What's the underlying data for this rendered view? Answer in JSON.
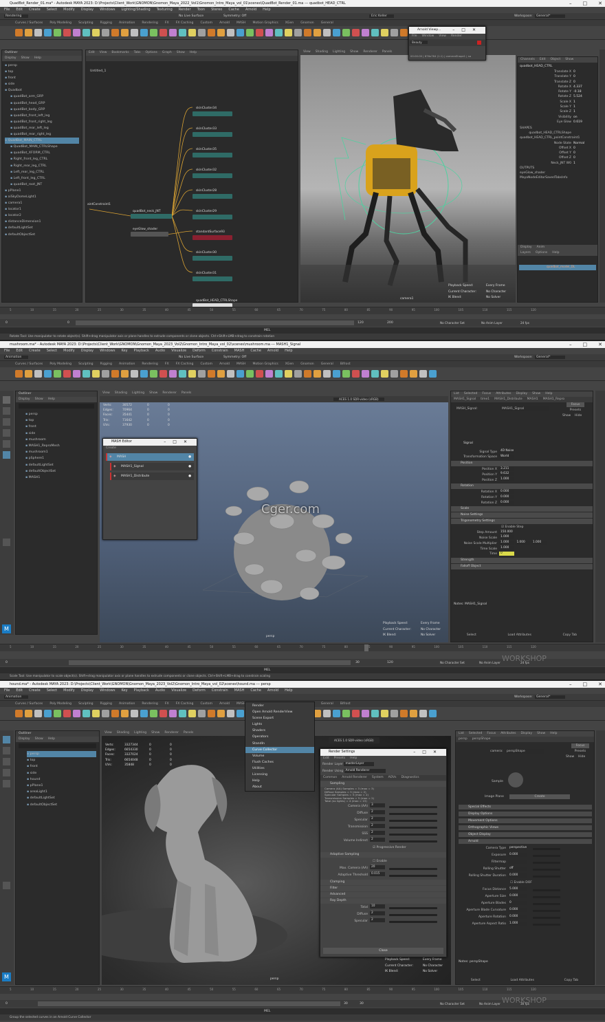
{
  "w1": {
    "title": "QuadBot_Render_01.ma* - Autodesk MAYA 2023: D:\\Projects\\Client_Work\\GNOMON\\Gnomon_Maya_2022_Vol1\\Gnomon_Intro_Maya_vol_01\\scenes\\QuadBot_Render_01.ma  ---  quadbot_HEAD_CTRL",
    "menus": [
      "File",
      "Edit",
      "Create",
      "Select",
      "Modify",
      "Display",
      "Windows",
      "Lighting/Shading",
      "Texturing",
      "Render",
      "Toon",
      "Stereo",
      "Cache",
      "Arnold",
      "Help"
    ],
    "workspace_label": "Workspace:",
    "workspace_value": "General*",
    "menuset": "Rendering",
    "live_surface": "No Live Surface",
    "symmetry": "Symmetry: Off",
    "user": "Eric Keller",
    "shelf_tabs": [
      "Curves / Surfaces",
      "Poly Modeling",
      "Sculpting",
      "Rigging",
      "Animation",
      "Rendering",
      "FX",
      "FX Caching",
      "Custom",
      "Arnold",
      "MASH",
      "Motion Graphics",
      "XGen",
      "Gnomon",
      "General"
    ],
    "outliner": {
      "title": "Outliner",
      "menus": [
        "Display",
        "Show",
        "Help"
      ],
      "items": [
        "persp",
        "top",
        "front",
        "side",
        "Quadbot",
        "quadBot_arm_GRP",
        "quadBot_head_GRP",
        "quadBot_body_GRP",
        "quadBot_front_left_leg",
        "quadBot_front_right_leg",
        "quadBot_rear_left_leg",
        "quadBot_rear_right_leg",
        "QuadBot_MAIN_CTRL",
        "QuadBot_MAIN_CTRLShape",
        "quadBot_XFORM_CTRL",
        "Right_front_leg_CTRL",
        "Right_rear_leg_CTRL",
        "Left_rear_leg_CTRL",
        "Left_front_leg_CTRL",
        "quadBot_root_JNT",
        "pPlane1",
        "aiSkyDomeLight1",
        "camera1",
        "locator1",
        "locator2",
        "distanceDimension1",
        "defaultLightSet",
        "defaultObjectSet"
      ]
    },
    "node_editor": {
      "menus": [
        "Edit",
        "View",
        "Bookmarks",
        "Tabs",
        "Options",
        "Graph",
        "Show",
        "Help"
      ],
      "tab": "Untitled_1",
      "nodes": [
        "skinCluster34",
        "skinCluster33",
        "skinCluster35",
        "skinCluster32",
        "skinCluster28",
        "skinCluster29",
        "standardSurface93",
        "skinCluster30",
        "skinCluster31",
        "quadBot_neck_JNT",
        "eyeGlow_shader",
        "quadBot_HEAD_CTRLShape",
        "aintConstraint1"
      ]
    },
    "viewport": {
      "menus": [
        "View",
        "Shading",
        "Lighting",
        "Show",
        "Renderer",
        "Panels"
      ],
      "camera": "camera1",
      "hud": [
        [
          "Playback Speed:",
          "Every Frame"
        ],
        [
          "Current Character:",
          "No Character"
        ],
        [
          "IK Blend:",
          "No Solver"
        ]
      ]
    },
    "arnold_view": {
      "title": "Arnold Viewp...",
      "menus": [
        "File",
        "Window",
        "View",
        "Render"
      ],
      "aov": "Beauty",
      "status": "00:00:00 | 876x764 (1:1) | cameraShape1 | sa"
    },
    "channel_box": {
      "menus": [
        "Channels",
        "Edit",
        "Object",
        "Show"
      ],
      "object": "quadbot_HEAD_CTRL",
      "channels": [
        [
          "Translate X",
          "0"
        ],
        [
          "Translate Y",
          "0"
        ],
        [
          "Translate Z",
          "0"
        ],
        [
          "Rotate X",
          "4.337"
        ],
        [
          "Rotate Y",
          "-0.18"
        ],
        [
          "Rotate Z",
          "5.524"
        ],
        [
          "Scale X",
          "1"
        ],
        [
          "Scale Y",
          "1"
        ],
        [
          "Scale Z",
          "1"
        ],
        [
          "Visibility",
          "on"
        ],
        [
          "Eye Glow",
          "0.619"
        ]
      ],
      "shapes_label": "SHAPES",
      "shapes": [
        [
          "quadbot_HEAD_CTRLShape",
          ""
        ],
        [
          "quadbot_HEAD_CTRL_pointConstraint1",
          ""
        ],
        [
          "Node State",
          "Normal"
        ],
        [
          "Offset X",
          "0"
        ],
        [
          "Offset Y",
          "0"
        ],
        [
          "Offset Z",
          "0"
        ],
        [
          "Neck_JNT W0",
          "1"
        ]
      ],
      "outputs_label": "OUTPUTS",
      "outputs": [
        "eyeGlow_shader",
        "MayaNodeEditorSavedTabsInfo"
      ],
      "layer_tabs": [
        "Display",
        "Anim"
      ],
      "layer_menus": [
        "Layers",
        "Options",
        "Help"
      ],
      "layer_row": "quadbot_model_DL"
    },
    "timeline_ticks": [
      "5",
      "10",
      "15",
      "20",
      "25",
      "30",
      "35",
      "40",
      "45",
      "50",
      "55",
      "60",
      "65",
      "70",
      "75",
      "80",
      "85",
      "90",
      "95",
      "100",
      "105",
      "110",
      "115",
      "120"
    ],
    "range": {
      "start": "0",
      "start2": "0",
      "r1": "120",
      "r2": "120",
      "r3": "200",
      "fps": "24 fps",
      "char": "No Character Set",
      "anim": "No Anim Layer"
    },
    "cmd_lang": "MEL",
    "help": "Rotate Tool: Use manipulator to rotate object(s). Shift+drag manipulator axis or plane handles to extrude components or clone objects. Ctrl+Shift+LMB+drag to constrain rotation"
  },
  "w2": {
    "title": "mushroom.ma* - Autodesk MAYA 2023: D:\\Projects\\Client_Work\\GNOMON\\Gnomon_Maya_2023_Vol2\\Gnomon_Intro_Maya_vol_02\\scenes\\mushroom.ma  ---  MASH1_Signal",
    "menus": [
      "File",
      "Edit",
      "Create",
      "Select",
      "Modify",
      "Display",
      "Windows",
      "Key",
      "Playback",
      "Audio",
      "Visualize",
      "Deform",
      "Constrain",
      "MASH",
      "Cache",
      "Arnold",
      "Help"
    ],
    "menuset": "Animation",
    "shelf_tabs": [
      "Curves / Surfaces",
      "Poly Modeling",
      "Sculpting",
      "Rigging",
      "Animation",
      "Rendering",
      "FX",
      "FX Caching",
      "Custom",
      "Arnold",
      "MASH",
      "Motion Graphics",
      "XGen",
      "Gnomon",
      "General",
      "Bifrost"
    ],
    "outliner_items": [
      "persp",
      "top",
      "front",
      "side",
      "mushroom",
      "MASH1_ReproMesh",
      "mushroom1",
      "pSphere1",
      "defaultLightSet",
      "defaultObjectSet",
      "MASH1"
    ],
    "stats": [
      [
        "Verts:",
        "30572",
        "0",
        "0"
      ],
      [
        "Edges:",
        "70964",
        "0",
        "0"
      ],
      [
        "Faces:",
        "35441",
        "0",
        "0"
      ],
      [
        "Tris:",
        "71642",
        "0",
        "0"
      ],
      [
        "UVs:",
        "37930",
        "0",
        "0"
      ]
    ],
    "colorspace": "ACES 1.0 SDR-video (sRGB)",
    "cam": "persp",
    "mash": {
      "title": "MASH Editor",
      "create": "Create",
      "items": [
        "MASH",
        "MASH1_Signal",
        "MASH1_Distribute"
      ]
    },
    "ae": {
      "menus": [
        "List",
        "Selected",
        "Focus",
        "Attributes",
        "Display",
        "Show",
        "Help"
      ],
      "tabs": [
        "MASH1_Signal",
        "time1",
        "MASH1_Distribute",
        "MASH1",
        "MASH1_Repro"
      ],
      "node_label": "MASH_Signal:",
      "node_value": "MASH1_Signal",
      "focus": "Focus",
      "presets": "Presets",
      "show": "Show",
      "hide": "Hide",
      "signal": "Signal",
      "rows": [
        [
          "Signal Type",
          "4D Noise"
        ],
        [
          "Transformation Space",
          "World"
        ]
      ],
      "position_label": "Position",
      "position": [
        [
          "Position X",
          "3.211"
        ],
        [
          "Position Y",
          "9.632"
        ],
        [
          "Position Z",
          "1.000"
        ]
      ],
      "rotation_label": "Rotation",
      "rotation": [
        [
          "Rotation X",
          "0.000"
        ],
        [
          "Rotation Y",
          "0.000"
        ],
        [
          "Rotation Z",
          "0.000"
        ]
      ],
      "scale_label": "Scale",
      "noise_label": "Noise Settings",
      "trig_label": "Trigonometry Settings",
      "enable_step": "Enable Step",
      "step_amount": [
        "Step Amount",
        "150.000"
      ],
      "noise_scale": [
        "Noise Scale",
        "1.000"
      ],
      "noise_mult": [
        "Noise Scale Multiplier",
        "1.000",
        "1.000",
        "1.000"
      ],
      "time_scale": [
        "Time Scale",
        "1.000"
      ],
      "time": [
        "Time",
        "0"
      ],
      "strength_label": "Strength",
      "falloff_label": "Falloff Object",
      "notes": "Notes:  MASH1_Signal",
      "buttons": [
        "Select",
        "Load Attributes",
        "Copy Tab"
      ]
    },
    "range": {
      "start": "0",
      "r1": "30",
      "r2": "120",
      "char": "No Character Set",
      "anim": "No Anim Layer",
      "fps": "24 fps",
      "cur": "22"
    },
    "help": "Scale Tool: Use manipulator to scale object(s). Shift+drag manipulator axis or plane handles to extrude components or clone objects. Ctrl+Shift+LMB+drag to constrain scaling"
  },
  "w3": {
    "title": "hound.ma* - Autodesk MAYA 2023: D:\\Projects\\Client_Work\\GNOMON\\Gnomon_Maya_2023_Vol2\\Gnomon_Intro_Maya_vol_02\\scenes\\hound.ma  ---  persp",
    "menus": [
      "File",
      "Edit",
      "Create",
      "Select",
      "Modify",
      "Display",
      "Windows",
      "Key",
      "Playback",
      "Audio",
      "Visualize",
      "Deform",
      "Constrain",
      "MASH",
      "Cache",
      "Arnold",
      "Help"
    ],
    "outliner_items": [
      "persp",
      "top",
      "front",
      "side",
      "hound",
      "pPlane1",
      "areaLight1",
      "defaultLightSet",
      "defaultObjectSet"
    ],
    "stats": [
      [
        "Verts:",
        "3327344",
        "0",
        "0"
      ],
      [
        "Edges:",
        "6654330",
        "0",
        "0"
      ],
      [
        "Faces:",
        "3327024",
        "0",
        "0"
      ],
      [
        "Tris:",
        "6654048",
        "0",
        "0"
      ],
      [
        "UVs:",
        "35848",
        "0",
        "0"
      ]
    ],
    "arnold_menu": [
      "Render",
      "Open Arnold RenderView",
      "Scene Export",
      "Lights",
      "Shaders",
      "Operators",
      "StandIn",
      "Curve Collector",
      "Volume",
      "Flush Caches",
      "Utilities",
      "Licensing",
      "Help",
      "About"
    ],
    "arnold_menu_sel": "Curve Collector",
    "render_settings": {
      "title": "Render Settings",
      "menus": [
        "Edit",
        "Presets",
        "Help"
      ],
      "layer_label": "Render Layer",
      "layer": "masterLayer",
      "using_label": "Render Using",
      "using": "Arnold Renderer",
      "tabs": [
        "Common",
        "Arnold Renderer",
        "System",
        "AOVs",
        "Diagnostics"
      ],
      "sampling": "Sampling",
      "sampling_info": [
        "Camera (AA) Samples = 3 (max = 3)",
        "Diffuse Samples = 5 (max = 2)",
        "Specular Samples = 5 (max = 2)",
        "Transmission Samples = 5 (max = 2)",
        "Total (no lights) = 4 (max = 15)"
      ],
      "rows": [
        [
          "Camera (AA)",
          "3"
        ],
        [
          "Diffuse",
          "2"
        ],
        [
          "Specular",
          "2"
        ],
        [
          "Transmission",
          "2"
        ],
        [
          "SSS",
          "2"
        ],
        [
          "Volume Indirect",
          "2"
        ]
      ],
      "progressive": "Progressive Render",
      "adaptive": "Adaptive Sampling",
      "enable": "Enable",
      "max_cam": [
        "Max. Camera (AA)",
        "20"
      ],
      "threshold": [
        "Adaptive Threshold",
        "0.015"
      ],
      "clamping": "Clamping",
      "filter": "Filter",
      "advanced": "Advanced",
      "ray_depth": "Ray Depth",
      "ray_rows": [
        [
          "Total",
          "10"
        ],
        [
          "Diffuse",
          "2"
        ],
        [
          "Specular",
          "2"
        ]
      ],
      "close": "Close"
    },
    "ae": {
      "menus": [
        "List",
        "Selected",
        "Focus",
        "Attributes",
        "Display",
        "Show",
        "Help"
      ],
      "tabs": [
        "persp",
        "perspShape"
      ],
      "camera_label": "camera:",
      "camera_value": "perspShape",
      "sample": "Sample",
      "image_plane": "Image Plane",
      "create": "Create",
      "sections": [
        "Special Effects",
        "Display Options",
        "Movement Options",
        "Orthographic Views",
        "Object Display",
        "Arnold"
      ],
      "rows": [
        [
          "Camera Type",
          "perspective"
        ],
        [
          "Exposure",
          "0.000"
        ],
        [
          "Filtermap",
          ""
        ],
        [
          "Rolling Shutter",
          "off"
        ],
        [
          "Rolling Shutter Duration",
          "0.000"
        ]
      ],
      "enable_dof": "Enable DOF",
      "dof_rows": [
        [
          "Focus Distance",
          "5.000"
        ],
        [
          "Aperture Size",
          "0.000"
        ],
        [
          "Aperture Blades",
          "0"
        ],
        [
          "Aperture Blade Curvature",
          "0.000"
        ],
        [
          "Aperture Rotation",
          "0.000"
        ],
        [
          "Aperture Aspect Ratio",
          "1.000"
        ]
      ],
      "notes": "Notes:  perspShape",
      "buttons": [
        "Select",
        "Load Attributes",
        "Copy Tab"
      ]
    },
    "cam": "persp",
    "hud": [
      [
        "Playback Speed:",
        "Every Frame"
      ],
      [
        "Current Character:",
        "No Character"
      ],
      [
        "IK Blend:",
        "No Solver"
      ]
    ],
    "range": {
      "start": "0",
      "r1": "30",
      "r2": "30",
      "char": "No Character Set",
      "anim": "No Anim Layer",
      "fps": "30 fps"
    },
    "help": "Group the selected curves in an Arnold Curve Collector"
  },
  "watermark": "Cger.com",
  "brand": "WORKSHOP"
}
